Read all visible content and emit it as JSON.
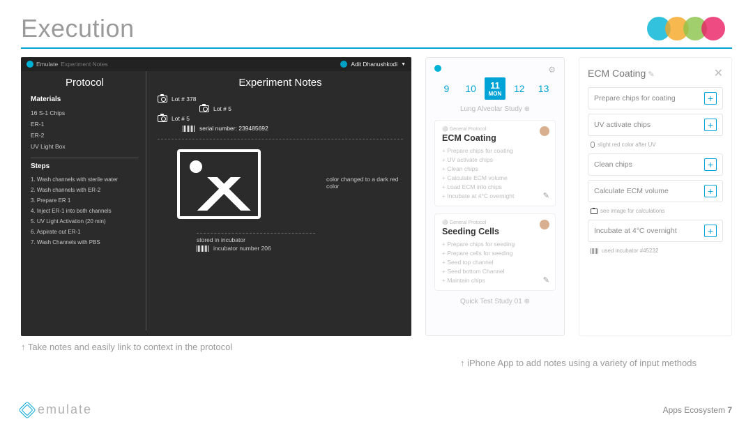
{
  "slide": {
    "title": "Execution",
    "caption_left": "↑ Take notes and easily link to context in the protocol",
    "caption_right": "↑ iPhone App to add notes using a variety of input methods",
    "footer_brand": "emulate",
    "footer_label": "Apps Ecosystem",
    "footer_page": "7"
  },
  "dark": {
    "app_name": "Emulate",
    "app_sub": "Experiment Notes",
    "user": "Adit Dhanushkodi",
    "protocol_heading": "Protocol",
    "notes_heading": "Experiment Notes",
    "materials_heading": "Materials",
    "materials": [
      "16 S-1 Chips",
      "ER-1",
      "ER-2",
      "UV Light Box"
    ],
    "steps_heading": "Steps",
    "steps": [
      "1. Wash channels with sterile water",
      "2. Wash channels with ER-2",
      "3. Prepare ER 1",
      "4. Inject ER-1 into both channels",
      "5. UV Light Activation (20 min)",
      "6. Aspirate out ER-1",
      "7. Wash Channels with PBS"
    ],
    "lot1": "Lot # 378",
    "lot2": "Lot # 5",
    "lot3": "Lot # 5",
    "serial": "serial number: 239485692",
    "img_note": "color changed to a dark red color",
    "stored_label": "stored in incubator",
    "stored_sub": "incubator number 206"
  },
  "phone1": {
    "dates": {
      "d1": "9",
      "d2": "10",
      "sel_num": "11",
      "sel_dow": "MON",
      "d4": "12",
      "d5": "13"
    },
    "study_top": "Lung Alveolar Study",
    "card1": {
      "tag": "⚪ General Protocol",
      "title": "ECM Coating",
      "steps": [
        "Prepare chips for coating",
        "UV activate chips",
        "Clean chips",
        "Calculate ECM volume",
        "Load ECM into chips",
        "Incubate at 4°C overnight"
      ]
    },
    "card2": {
      "tag": "⚪ General Protocol",
      "title": "Seeding Cells",
      "steps": [
        "Prepare chips for seeding",
        "Prepare cells for seeding",
        "Seed top channel",
        "Seed bottom Channel",
        "Maintain chips"
      ]
    },
    "study_bottom": "Quick Test Study 01"
  },
  "phone2": {
    "title": "ECM Coating",
    "rows": [
      "Prepare chips for coating",
      "UV activate chips"
    ],
    "note1": "slight red color after UV",
    "rows2": [
      "Clean chips",
      "Calculate ECM volume"
    ],
    "note2": "see image for calculations",
    "rows3": [
      "Incubate at 4°C overnight"
    ],
    "note3": "used incubator #45232"
  }
}
